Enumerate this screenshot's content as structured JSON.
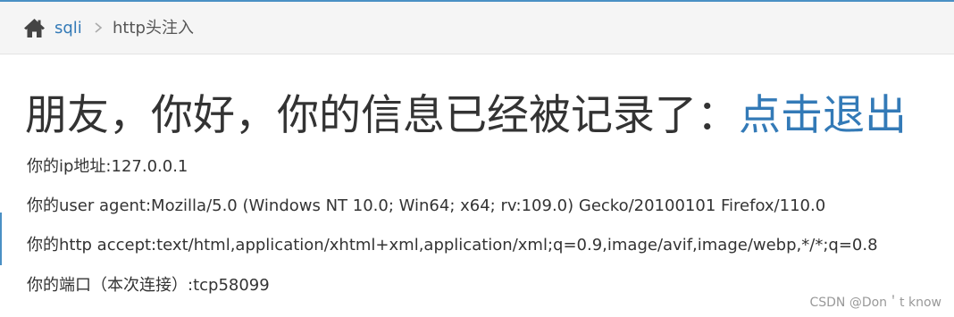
{
  "breadcrumb": {
    "home_icon": "home-icon",
    "link_label": "sqli",
    "separator_icon": "chevron-right-icon",
    "current_label": "http头注入"
  },
  "headline": {
    "text": "朋友，你好，你的信息已经被记录了：",
    "logout_link": "点击退出"
  },
  "info": {
    "ip": "你的ip地址:127.0.0.1",
    "user_agent": "你的user agent:Mozilla/5.0 (Windows NT 10.0; Win64; x64; rv:109.0) Gecko/20100101 Firefox/110.0",
    "http_accept": "你的http accept:text/html,application/xhtml+xml,application/xml;q=0.9,image/avif,image/webp,*/*;q=0.8",
    "port": "你的端口（本次连接）:tcp58099"
  },
  "watermark": "CSDN @Don＇t know",
  "colors": {
    "link": "#337ab7",
    "text": "#333333",
    "breadcrumb_bg": "#f5f5f5",
    "accent": "#4a90c4"
  }
}
